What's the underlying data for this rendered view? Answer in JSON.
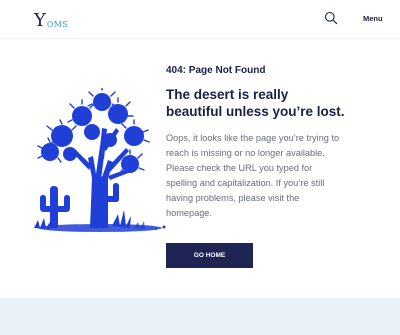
{
  "header": {
    "logo_mark": "Y",
    "logo_text": "OMS",
    "search_icon": "search-icon",
    "menu_label": "Menu"
  },
  "main": {
    "eyebrow": "404: Page Not Found",
    "title_line1": "The desert is really",
    "title_line2": "beautiful unless you’re lost.",
    "body_line1": "Oops, it looks like the page you’re trying to",
    "body_line2": "reach is missing or no longer available.",
    "body_line3": "Please check the URL you typed for",
    "body_line4": "spelling and capitalization. If you’re still",
    "body_line5": "having problems, please visit the",
    "body_line6": "homepage.",
    "button_label": "GO HOME"
  },
  "colors": {
    "navy": "#1e2454",
    "illustration_blue": "#1f3fd6",
    "accent_teal": "#3aa3c9",
    "footer_band": "#e8f2f8"
  }
}
